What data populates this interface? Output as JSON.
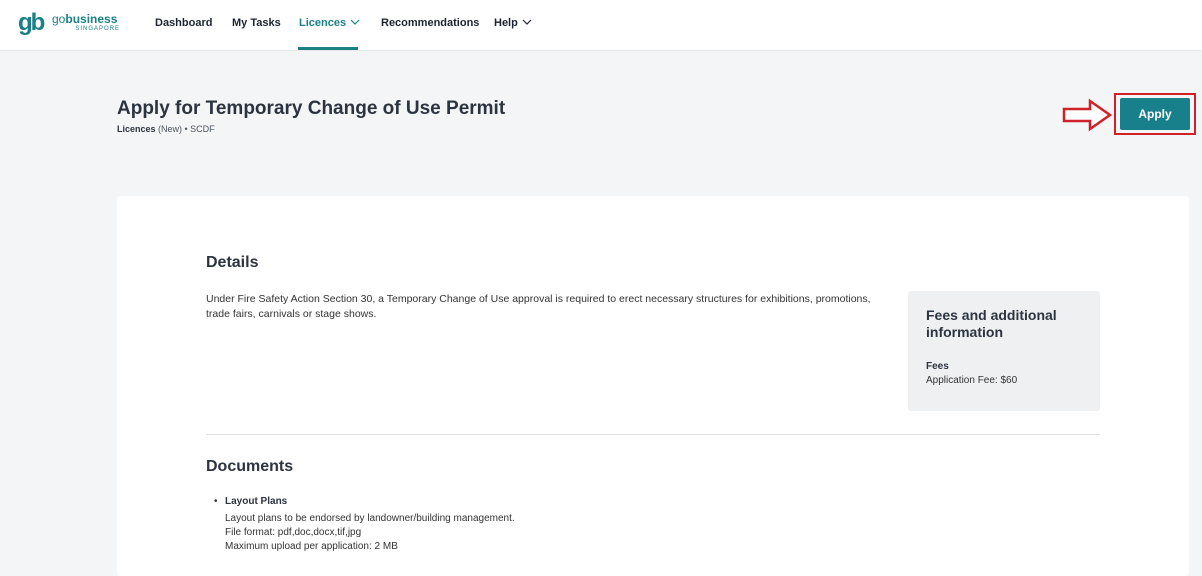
{
  "nav": {
    "logo_prefix": "go",
    "logo_bold": "business",
    "logo_sub": "SINGAPORE",
    "items": [
      {
        "label": "Dashboard"
      },
      {
        "label": "My Tasks"
      },
      {
        "label": "Licences"
      },
      {
        "label": "Recommendations"
      },
      {
        "label": "Help"
      }
    ],
    "active_index": 2
  },
  "header": {
    "title": "Apply for Temporary Change of Use Permit",
    "breadcrumb_bold": "Licences",
    "breadcrumb_rest": " (New) • SCDF",
    "apply_label": "Apply"
  },
  "details": {
    "title": "Details",
    "text": "Under Fire Safety Action Section 30, a Temporary Change of Use approval is required to erect necessary structures for exhibitions, promotions, trade fairs, carnivals or stage shows."
  },
  "fees": {
    "title": "Fees and additional information",
    "label": "Fees",
    "value": "Application Fee: $60"
  },
  "documents": {
    "title": "Documents",
    "items": [
      {
        "name": "Layout Plans",
        "description": "Layout plans to be endorsed by landowner/building management.",
        "format": "File format: pdf,doc,docx,tif,jpg",
        "max_upload": "Maximum upload per application: 2 MB"
      }
    ]
  },
  "colors": {
    "accent": "#17808a",
    "highlight": "#d0212a"
  }
}
